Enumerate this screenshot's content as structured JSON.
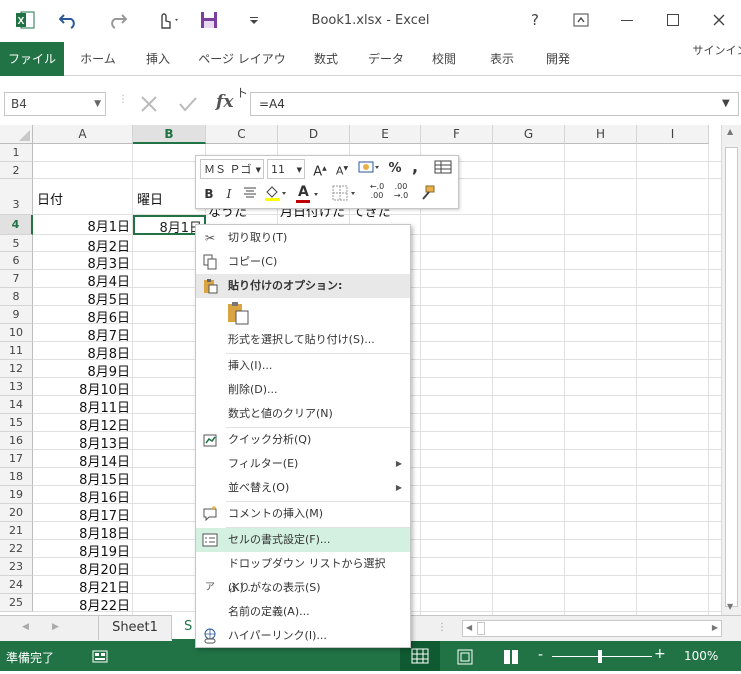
{
  "window": {
    "title": "Book1.xlsx - Excel",
    "help": "?",
    "colors": {
      "accent": "#217346",
      "selection_highlight": "#d3f0e0"
    }
  },
  "quick_access": {
    "excel_icon": "excel-icon",
    "undo": "undo-icon",
    "redo": "redo-icon",
    "touch": "touch-mode-icon",
    "save": "save-icon",
    "customize": "customize-icon"
  },
  "ribbon": {
    "tabs": [
      "ファイル",
      "ホーム",
      "挿入",
      "ページ レイアウト",
      "数式",
      "データ",
      "校閲",
      "表示",
      "開発"
    ],
    "signin": "サインイン"
  },
  "formula_bar": {
    "name_box": "B4",
    "formula": "=A4",
    "fx": "fx"
  },
  "grid": {
    "columns": [
      "A",
      "B",
      "C",
      "D",
      "E",
      "F",
      "G",
      "H",
      "I"
    ],
    "selected_column": "B",
    "selected_row": "4",
    "rows": [
      "1",
      "2",
      "3",
      "4",
      "5",
      "6",
      "7",
      "8",
      "9",
      "10",
      "11",
      "12",
      "13",
      "14",
      "15",
      "16",
      "17",
      "18",
      "19",
      "20",
      "21",
      "22",
      "23",
      "24",
      "25"
    ],
    "a3": "日付",
    "b3": "曜日",
    "c3_partial": "なうた",
    "d3_partial": "月日付けた",
    "e3_partial": "てきた",
    "dates": [
      "8月1日",
      "8月2日",
      "8月3日",
      "8月4日",
      "8月5日",
      "8月6日",
      "8月7日",
      "8月8日",
      "8月9日",
      "8月10日",
      "8月11日",
      "8月12日",
      "8月13日",
      "8月14日",
      "8月15日",
      "8月16日",
      "8月17日",
      "8月18日",
      "8月19日",
      "8月20日",
      "8月21日",
      "8月22日"
    ],
    "b4": "8月1日"
  },
  "mini_toolbar": {
    "font": "ＭＳ Ｐゴ",
    "size": "11",
    "grow_font": "A",
    "shrink_font": "A",
    "percent": "%",
    "comma": ",",
    "bold": "B",
    "italic": "I",
    "font_color_letter": "A",
    "dec_increase": "←.0\n.00",
    "dec_decrease": ".00\n→.0"
  },
  "context_menu": {
    "items": [
      {
        "label": "切り取り(T)",
        "icon": "scissors-icon"
      },
      {
        "label": "コピー(C)",
        "icon": "copy-icon"
      },
      {
        "label": "貼り付けのオプション:",
        "icon": "paste-icon"
      },
      {
        "label": "形式を選択して貼り付け(S)..."
      },
      {
        "label": "挿入(I)..."
      },
      {
        "label": "削除(D)..."
      },
      {
        "label": "数式と値のクリア(N)"
      },
      {
        "label": "クイック分析(Q)",
        "icon": "quick-analysis-icon"
      },
      {
        "label": "フィルター(E)"
      },
      {
        "label": "並べ替え(O)"
      },
      {
        "label": "コメントの挿入(M)",
        "icon": "comment-icon"
      },
      {
        "label": "セルの書式設定(F)...",
        "icon": "format-cells-icon"
      },
      {
        "label": "ドロップダウン リストから選択(K)..."
      },
      {
        "label": "ふりがなの表示(S)",
        "icon": "furigana-icon"
      },
      {
        "label": "名前の定義(A)..."
      },
      {
        "label": "ハイパーリンク(I)...",
        "icon": "hyperlink-icon"
      }
    ]
  },
  "sheets": {
    "tabs": [
      "Sheet1",
      "S"
    ]
  },
  "status_bar": {
    "ready": "準備完了",
    "zoom": "100%",
    "minus": "-",
    "plus": "+"
  }
}
